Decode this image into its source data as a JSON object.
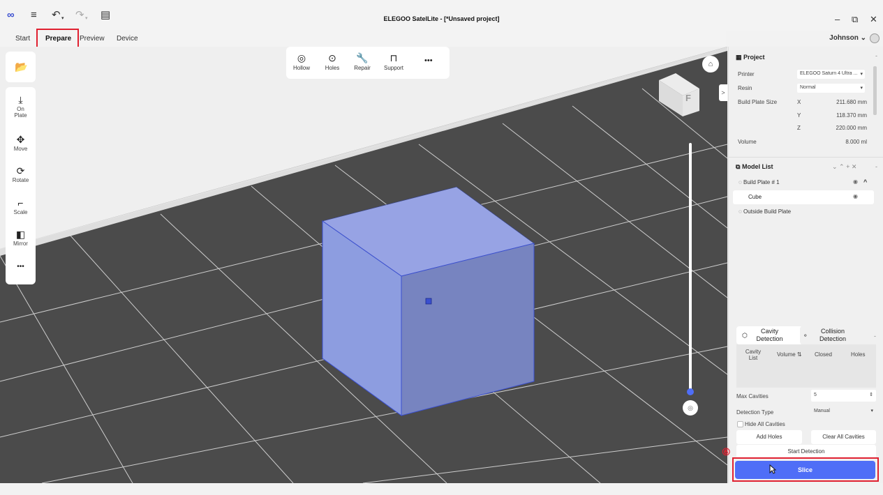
{
  "window": {
    "title": "ELEGOO SatelLite - [*Unsaved project]",
    "minimize": "–",
    "restore": "⧉",
    "close": "✕"
  },
  "titlebar_icons": {
    "logo": "∞",
    "menu": "≡",
    "undo": "↶",
    "undo_caret": "▾",
    "redo": "↷",
    "redo_caret": "▾",
    "save": "▤"
  },
  "tabs": [
    {
      "label": "Start"
    },
    {
      "label": "Prepare"
    },
    {
      "label": "Preview"
    },
    {
      "label": "Device"
    }
  ],
  "user": {
    "name": "Johnson",
    "caret": "⌄"
  },
  "annotations": {
    "step5": "⑤",
    "step6": "⑥"
  },
  "left_tools": {
    "open_icon": "📂",
    "items": [
      {
        "label_1": "On",
        "label_2": "Plate",
        "icon": "⤓"
      },
      {
        "label": "Move",
        "icon": "✥"
      },
      {
        "label": "Rotate",
        "icon": "⟳"
      },
      {
        "label": "Scale",
        "icon": "⌐"
      },
      {
        "label": "Mirror",
        "icon": "◧"
      }
    ],
    "more": "•••"
  },
  "top_tools": [
    {
      "label": "Hollow",
      "icon": "◎"
    },
    {
      "label": "Holes",
      "icon": "⊙"
    },
    {
      "label": "Repair",
      "icon": "🔧"
    },
    {
      "label": "Support",
      "icon": "⊓"
    }
  ],
  "top_tools_more": "•••",
  "viewport": {
    "home_icon": "⌂",
    "cube_face": "F",
    "collapse_arrow": ">",
    "slider_btn_icon": "◎"
  },
  "project": {
    "title": "Project",
    "title_icon": "▦",
    "collapse": "-",
    "printer_label": "Printer",
    "printer_value": "ELEGOO Saturn 4 Ultra ...",
    "resin_label": "Resin",
    "resin_value": "Normal",
    "plate_label": "Build Plate Size",
    "x_label": "X",
    "x_value": "211.680 mm",
    "y_label": "Y",
    "y_value": "118.370 mm",
    "z_label": "Z",
    "z_value": "220.000 mm",
    "volume_label": "Volume",
    "volume_value": "8.000 ml",
    "dropdown_caret": "▾"
  },
  "model_list": {
    "title": "Model List",
    "title_icon": "⧉",
    "actions": "⌄ ⌃ + ✕",
    "collapse": "-",
    "plate": "Build Plate # 1",
    "item": "Cube",
    "outside": "Outside Build Plate",
    "eye_icon": "◉",
    "caret_up": "^"
  },
  "detection": {
    "tab1_1": "Cavity",
    "tab1_2": "Detection",
    "tab2_1": "Collision",
    "tab2_2": "Detection",
    "collapse": "-",
    "col_list_1": "Cavity",
    "col_list_2": "List",
    "col_volume": "Volume ⇅",
    "col_closed": "Closed",
    "col_holes": "Holes",
    "max_cavities_label": "Max Cavities",
    "max_cavities_value": "5",
    "detection_type_label": "Detection Type",
    "detection_type_value": "Manual",
    "hide_all": "Hide All Cavities",
    "add_holes": "Add Holes",
    "clear_all": "Clear All Cavities",
    "start": "Start Detection",
    "stepper": "⇕"
  },
  "slice": {
    "label": "Slice"
  },
  "colors": {
    "accent": "#4f6ef7",
    "highlight": "#e02030",
    "cube_front": "#8d9de0",
    "cube_side": "#7784c0",
    "cube_top": "#97a3e4"
  }
}
